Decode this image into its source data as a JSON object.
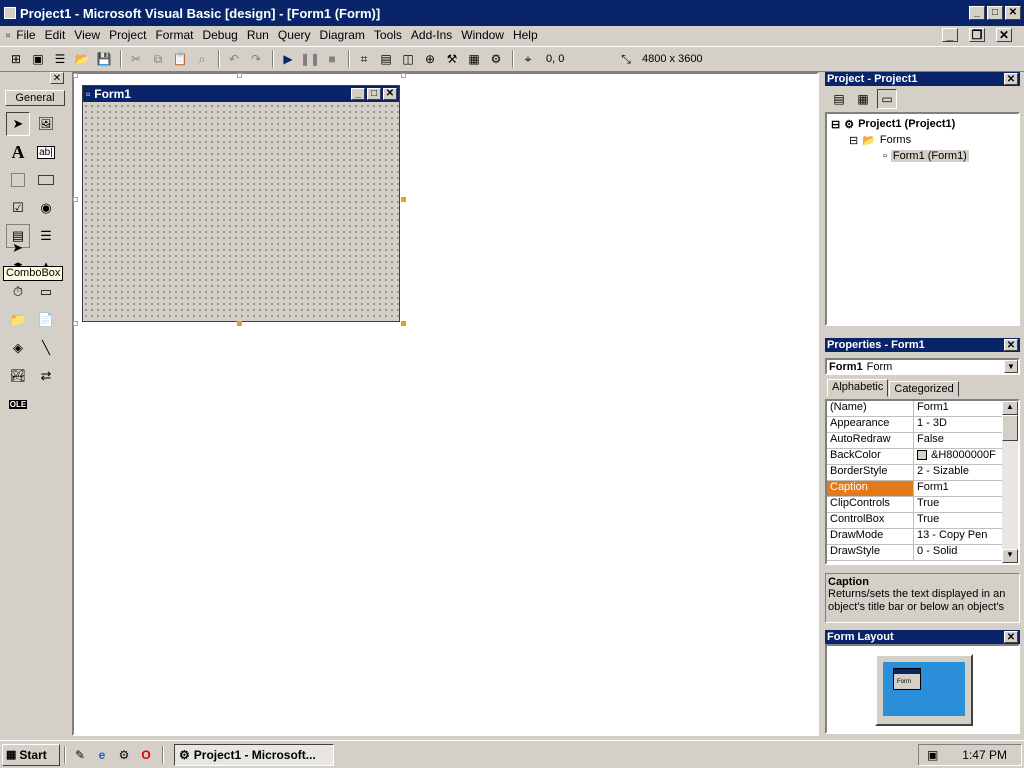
{
  "window": {
    "title": "Project1 - Microsoft Visual Basic [design] - [Form1 (Form)]"
  },
  "menu": [
    "File",
    "Edit",
    "View",
    "Project",
    "Format",
    "Debug",
    "Run",
    "Query",
    "Diagram",
    "Tools",
    "Add-Ins",
    "Window",
    "Help"
  ],
  "toolbar": {
    "position": "0, 0",
    "size": "4800 x 3600"
  },
  "toolbox": {
    "tab_label": "General",
    "tooltip": "ComboBox"
  },
  "form": {
    "title": "Form1"
  },
  "project": {
    "title": "Project - Project1",
    "tree": [
      "Project1 (Project1)",
      "Forms",
      "Form1 (Form1)"
    ]
  },
  "properties": {
    "title": "Properties - Form1",
    "object_name": "Form1",
    "object_type": "Form",
    "tabs": [
      "Alphabetic",
      "Categorized"
    ],
    "rows": [
      {
        "name": "(Name)",
        "value": "Form1"
      },
      {
        "name": "Appearance",
        "value": "1 - 3D"
      },
      {
        "name": "AutoRedraw",
        "value": "False"
      },
      {
        "name": "BackColor",
        "value": "&H8000000F"
      },
      {
        "name": "BorderStyle",
        "value": "2 - Sizable"
      },
      {
        "name": "Caption",
        "value": "Form1"
      },
      {
        "name": "ClipControls",
        "value": "True"
      },
      {
        "name": "ControlBox",
        "value": "True"
      },
      {
        "name": "DrawMode",
        "value": "13 - Copy Pen"
      },
      {
        "name": "DrawStyle",
        "value": "0 - Solid"
      }
    ],
    "desc_title": "Caption",
    "desc_text": "Returns/sets the text displayed in an object's title bar or below an object's"
  },
  "form_layout": {
    "title": "Form Layout",
    "preview_label": "Form"
  },
  "taskbar": {
    "start": "Start",
    "task": "Project1 - Microsoft...",
    "clock": "1:47 PM"
  },
  "colors": {
    "title_bar": "#0a246a",
    "selected_row": "#e07a1a",
    "monitor_screen": "#2b8ed8",
    "face": "#d4d0c8"
  }
}
